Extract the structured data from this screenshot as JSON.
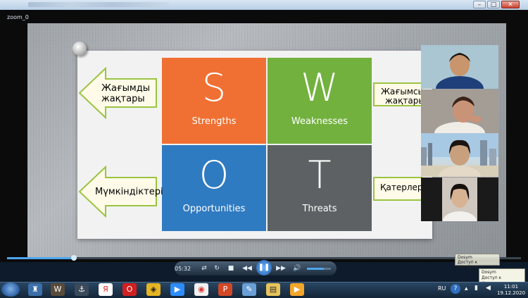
{
  "window": {
    "label": "zoom_0"
  },
  "slide": {
    "quadrants": [
      {
        "letter": "S",
        "word": "Strengths",
        "color": "#f07033"
      },
      {
        "letter": "W",
        "word": "Weaknesses",
        "color": "#73b13f"
      },
      {
        "letter": "O",
        "word": "Opportunities",
        "color": "#2f7bc1"
      },
      {
        "letter": "T",
        "word": "Threats",
        "color": "#5e6163"
      }
    ],
    "left_arrows": [
      {
        "line1": "Жағымды",
        "line2": "жақтары"
      },
      {
        "line1": "Мүмкіндіктері"
      }
    ],
    "right_arrows": [
      {
        "line1": "Жағымсыз",
        "line2": "жақтары"
      },
      {
        "line1": "Қатерлері"
      }
    ]
  },
  "player": {
    "time": "05:32",
    "progress": 0.13,
    "volume": 0.7,
    "tooltip_name": "Dosym",
    "tooltip_status": "Доступ к Интернету"
  },
  "tray": {
    "language": "RU",
    "time": "11:01",
    "date": "19.12.2020"
  },
  "colors": {
    "accent": "#4fa6ee",
    "taskbar": "#142638"
  }
}
